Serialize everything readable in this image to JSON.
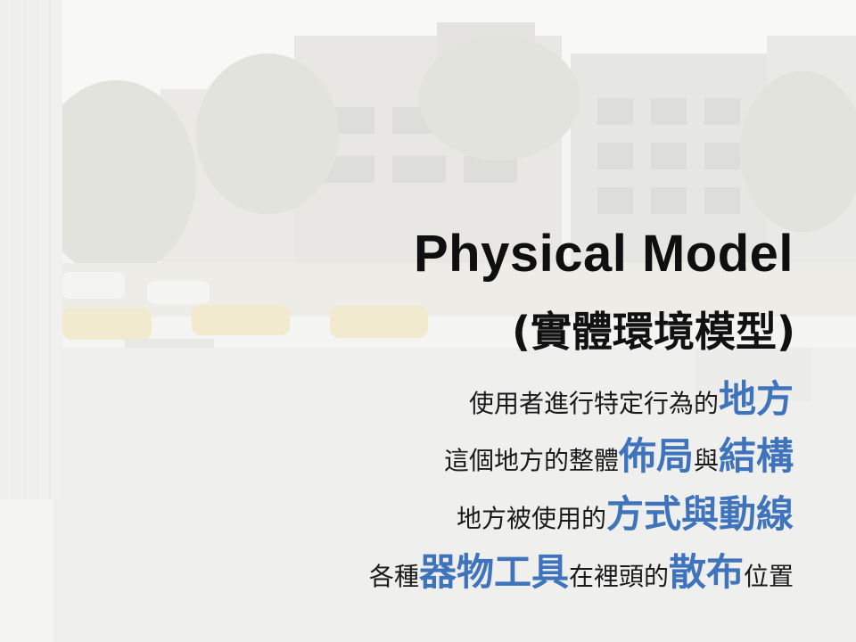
{
  "slide": {
    "title": "Physical Model",
    "subtitle": "(實體環境模型)",
    "lines": [
      [
        {
          "t": "使用者進行特定行為的",
          "h": false
        },
        {
          "t": "地方",
          "h": true
        }
      ],
      [
        {
          "t": "這個地方的整體",
          "h": false
        },
        {
          "t": "佈局",
          "h": true
        },
        {
          "t": "與",
          "h": false
        },
        {
          "t": "結構",
          "h": true
        }
      ],
      [
        {
          "t": "地方被使用的",
          "h": false
        },
        {
          "t": "方式與動線",
          "h": true
        }
      ],
      [
        {
          "t": "各種",
          "h": false
        },
        {
          "t": "器物工具",
          "h": true
        },
        {
          "t": "在裡頭的",
          "h": false
        },
        {
          "t": "散布",
          "h": true
        },
        {
          "t": "位置",
          "h": false
        }
      ]
    ]
  },
  "colors": {
    "highlight": "#3f74bc",
    "text": "#1a1a1a"
  }
}
